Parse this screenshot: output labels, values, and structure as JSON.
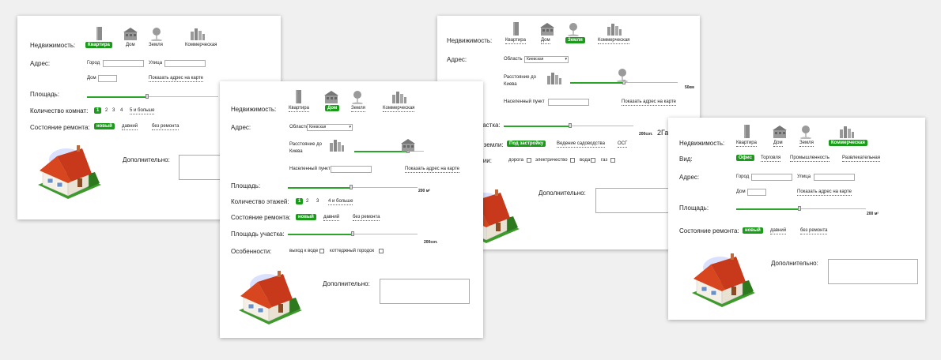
{
  "common": {
    "property_label": "Недвижимость:",
    "types": [
      "Квартира",
      "Дом",
      "Земля",
      "Коммерческая"
    ],
    "address_label": "Адрес:",
    "city_label": "Город",
    "street_label": "Улица",
    "house_label": "Дом",
    "show_on_map": "Показать адрес на карте",
    "area_label": "Площадь:",
    "repair_label": "Состояние ремонта:",
    "repair_options": [
      "новый",
      "давний",
      "без ремонта"
    ],
    "extra_label": "Дополнительно:",
    "region_label": "Область",
    "region_value": "Киевская",
    "distance_label": "Расстояние до Киева",
    "settlement_label": "Населенный пункт",
    "plot_area_label": "Площадь участка:"
  },
  "card1": {
    "selected_type": "Квартира",
    "rooms_label": "Количество комнат:",
    "rooms": [
      "1",
      "2",
      "3",
      "4",
      "5 и больше"
    ],
    "selected_room": "1"
  },
  "card2": {
    "selected_type": "Дом",
    "area_value": "200",
    "area_unit": "м²",
    "floors_label": "Количество этажей:",
    "floors": [
      "1",
      "2",
      "3",
      "4 и больше"
    ],
    "selected_floor": "1",
    "plot_value": "200сот.",
    "features_label": "Особенности:",
    "features": [
      "выход к воде",
      "коттеджный городок"
    ]
  },
  "card3": {
    "selected_type": "Земля",
    "distance_value": "50км",
    "plot_value": "200сот.",
    "plot_value2": "2Га",
    "purpose_label": "Назначение земли:",
    "purposes": [
      "Под застройку",
      "Ведение садоводства",
      "ОСГ"
    ],
    "selected_purpose": "Под застройку",
    "comm_label": "Коммуникации:",
    "comms": [
      "дорога",
      "электричество",
      "вода",
      "газ"
    ]
  },
  "card4": {
    "selected_type": "Коммерческая",
    "kind_label": "Вид:",
    "kinds": [
      "Офис",
      "Торговля",
      "Промышленность",
      "Развлекательная"
    ],
    "selected_kind": "Офис",
    "area_value": "200",
    "area_unit": "м²"
  },
  "colors": {
    "accent": "#1a9c1a",
    "slider": "#2aa52a"
  }
}
